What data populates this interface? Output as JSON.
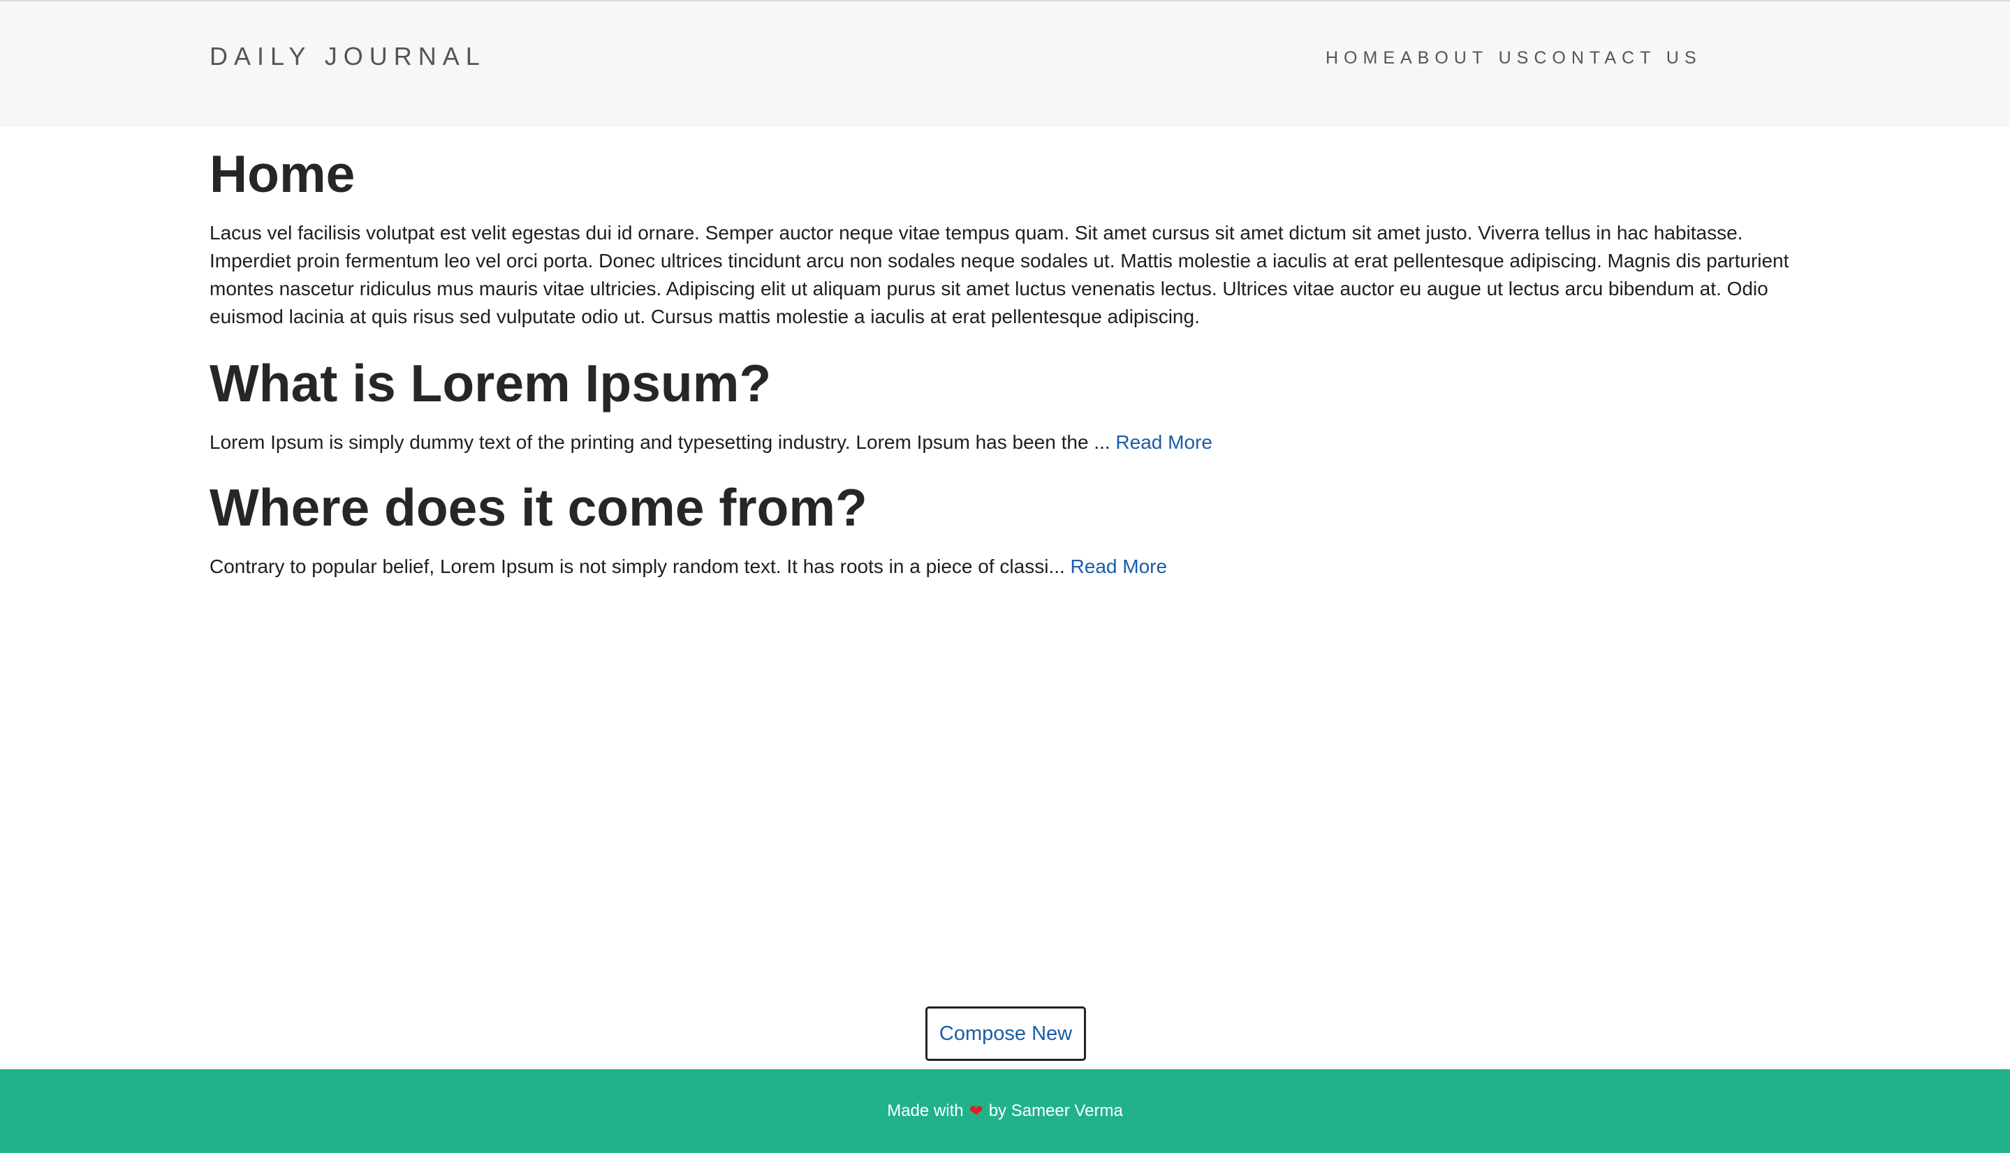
{
  "header": {
    "brand": "DAILY JOURNAL",
    "nav": [
      {
        "label": "HOME"
      },
      {
        "label": "ABOUT US"
      },
      {
        "label": "CONTACT US"
      }
    ]
  },
  "main": {
    "title": "Home",
    "intro": "Lacus vel facilisis volutpat est velit egestas dui id ornare. Semper auctor neque vitae tempus quam. Sit amet cursus sit amet dictum sit amet justo. Viverra tellus in hac habitasse. Imperdiet proin fermentum leo vel orci porta. Donec ultrices tincidunt arcu non sodales neque sodales ut. Mattis molestie a iaculis at erat pellentesque adipiscing. Magnis dis parturient montes nascetur ridiculus mus mauris vitae ultricies. Adipiscing elit ut aliquam purus sit amet luctus venenatis lectus. Ultrices vitae auctor eu augue ut lectus arcu bibendum at. Odio euismod lacinia at quis risus sed vulputate odio ut. Cursus mattis molestie a iaculis at erat pellentesque adipiscing.",
    "posts": [
      {
        "title": "What is Lorem Ipsum?",
        "excerpt": "Lorem Ipsum is simply dummy text of the printing and typesetting industry. Lorem Ipsum has been the ... ",
        "read_more": "Read More"
      },
      {
        "title": "Where does it come from?",
        "excerpt": "Contrary to popular belief, Lorem Ipsum is not simply random text. It has roots in a piece of classi... ",
        "read_more": "Read More"
      }
    ],
    "compose_label": "Compose New"
  },
  "footer": {
    "text_before": "Made with",
    "heart": "❤",
    "text_after": "by Sameer Verma",
    "icon": "heart-icon",
    "bg_color": "#21b28b"
  }
}
